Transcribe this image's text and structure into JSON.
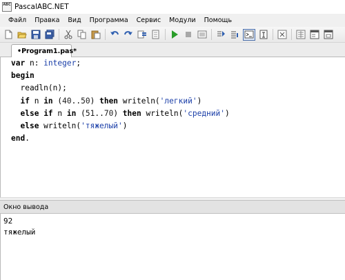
{
  "window": {
    "title": "PascalABC.NET",
    "icon_text": "ABC"
  },
  "menu": [
    "Файл",
    "Правка",
    "Вид",
    "Программа",
    "Сервис",
    "Модули",
    "Помощь"
  ],
  "toolbar": {
    "icons": [
      "new-file-icon",
      "open-folder-icon",
      "save-icon",
      "save-all-icon",
      "cut-icon",
      "copy-icon",
      "paste-icon",
      "undo-icon",
      "redo-icon",
      "find-icon",
      "find-next-icon",
      "run-icon",
      "stop-icon",
      "compile-icon",
      "step-over-icon",
      "step-into-icon",
      "output-window-icon",
      "input-window-icon",
      "close-icon",
      "formatter-icon",
      "form-designer-icon",
      "form-edit-icon"
    ]
  },
  "editor": {
    "tab_label": "•Program1.pas*",
    "lines": [
      [
        {
          "t": "var",
          "c": "kw"
        },
        {
          "t": " n: "
        },
        {
          "t": "integer",
          "c": "ty"
        },
        {
          "t": ";"
        }
      ],
      [
        {
          "t": "begin",
          "c": "kw"
        }
      ],
      [
        {
          "t": "  readln(n);"
        }
      ],
      [
        {
          "t": "  "
        },
        {
          "t": "if",
          "c": "kw"
        },
        {
          "t": " n "
        },
        {
          "t": "in",
          "c": "kw"
        },
        {
          "t": " ("
        },
        {
          "t": "40",
          "c": "num"
        },
        {
          "t": ".."
        },
        {
          "t": "50",
          "c": "num"
        },
        {
          "t": ") "
        },
        {
          "t": "then",
          "c": "kw"
        },
        {
          "t": " writeln("
        },
        {
          "t": "'легкий'",
          "c": "str"
        },
        {
          "t": ")"
        }
      ],
      [
        {
          "t": "  "
        },
        {
          "t": "else",
          "c": "kw"
        },
        {
          "t": " "
        },
        {
          "t": "if",
          "c": "kw"
        },
        {
          "t": " n "
        },
        {
          "t": "in",
          "c": "kw"
        },
        {
          "t": " ("
        },
        {
          "t": "51",
          "c": "num"
        },
        {
          "t": ".."
        },
        {
          "t": "70",
          "c": "num"
        },
        {
          "t": ") "
        },
        {
          "t": "then",
          "c": "kw"
        },
        {
          "t": " writeln("
        },
        {
          "t": "'средний'",
          "c": "str"
        },
        {
          "t": ")"
        }
      ],
      [
        {
          "t": "  "
        },
        {
          "t": "else",
          "c": "kw"
        },
        {
          "t": " writeln("
        },
        {
          "t": "'тяжелый'",
          "c": "str"
        },
        {
          "t": ")"
        }
      ],
      [
        {
          "t": "end",
          "c": "kw"
        },
        {
          "t": "."
        }
      ]
    ]
  },
  "output": {
    "header": "Окно вывода",
    "lines": [
      "92",
      "тяжелый"
    ]
  }
}
